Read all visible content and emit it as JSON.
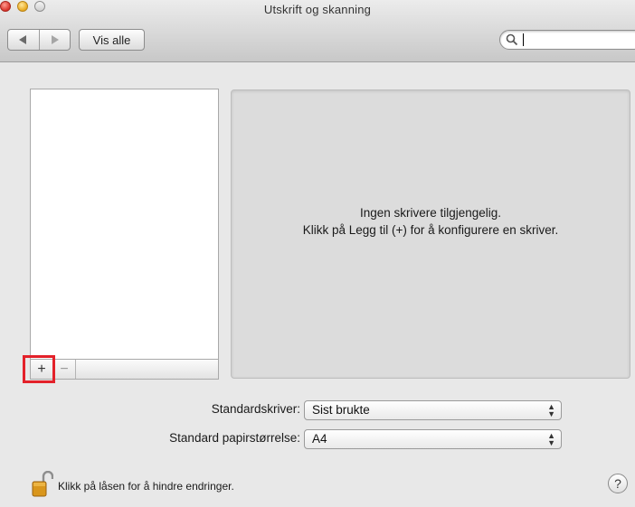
{
  "window": {
    "title": "Utskrift og skanning"
  },
  "toolbar": {
    "back_icon": "back-arrow-icon",
    "forward_icon": "forward-arrow-icon",
    "show_all_label": "Vis alle",
    "search": {
      "value": "",
      "placeholder": ""
    }
  },
  "printers": {
    "items": [],
    "add_label": "+",
    "remove_label": "−",
    "empty_message_line1": "Ingen skrivere tilgjengelig.",
    "empty_message_line2": "Klikk på Legg til (+) for å konfigurere en skriver."
  },
  "settings": {
    "default_printer_label": "Standardskriver:",
    "default_printer_value": "Sist brukte",
    "default_paper_label": "Standard papirstørrelse:",
    "default_paper_value": "A4"
  },
  "footer": {
    "lock_text": "Klikk på låsen for å hindre endringer.",
    "help_label": "?"
  },
  "colors": {
    "highlight": "#e3212a",
    "panel": "#dcdcdc",
    "window": "#e8e8e8"
  }
}
